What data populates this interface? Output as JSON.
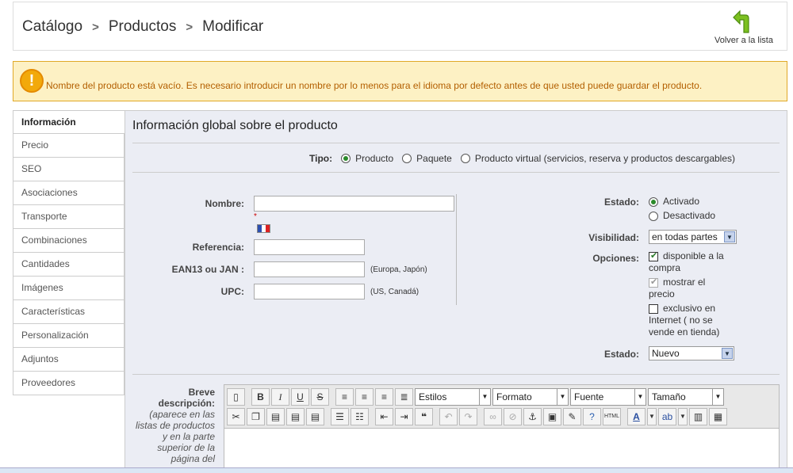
{
  "breadcrumb": {
    "items": [
      "Catálogo",
      "Productos",
      "Modificar"
    ],
    "separator": ">"
  },
  "back_button": {
    "label": "Volver a la lista",
    "icon": "arrow-back-icon"
  },
  "warning": {
    "icon": "!",
    "text": "Nombre del producto está vacío. Es necesario introducir un nombre por lo menos para el idioma por defecto antes de que usted puede guardar el producto."
  },
  "sidebar": {
    "items": [
      "Información",
      "Precio",
      "SEO",
      "Asociaciones",
      "Transporte",
      "Combinaciones",
      "Cantidades",
      "Imágenes",
      "Características",
      "Personalización",
      "Adjuntos",
      "Proveedores"
    ],
    "active_index": 0
  },
  "panel": {
    "title": "Información global sobre el producto",
    "tipo": {
      "label": "Tipo:",
      "options": [
        "Producto",
        "Paquete",
        "Producto virtual (servicios, reserva y productos descargables)"
      ],
      "selected_index": 0
    },
    "fields": {
      "nombre": {
        "label": "Nombre:",
        "value": "",
        "required_mark": "*"
      },
      "referencia": {
        "label": "Referencia:",
        "value": ""
      },
      "ean": {
        "label": "EAN13 ou JAN :",
        "value": "",
        "hint": "(Europa, Japón)"
      },
      "upc": {
        "label": "UPC:",
        "value": "",
        "hint": "(US, Canadá)"
      }
    },
    "estado": {
      "label": "Estado:",
      "options": [
        "Activado",
        "Desactivado"
      ],
      "selected_index": 0
    },
    "visibilidad": {
      "label": "Visibilidad:",
      "value": "en todas partes"
    },
    "opciones": {
      "label": "Opciones:",
      "items": [
        {
          "line1": "disponible a la",
          "line2": "compra",
          "checked": true,
          "disabled": false
        },
        {
          "line1": "mostrar el",
          "line2": "precio",
          "checked": true,
          "disabled": true
        },
        {
          "line1": "exclusivo en",
          "line2": "Internet ( no se",
          "line3": "vende en tienda)",
          "checked": false,
          "disabled": false
        }
      ]
    },
    "condicion": {
      "label": "Estado:",
      "value": "Nuevo"
    },
    "breve": {
      "label_line1": "Breve",
      "label_line2": "descripción:",
      "hint_lines": [
        "(aparece en las",
        "listas de productos",
        "y en la parte",
        "superior de la",
        "página del"
      ]
    },
    "editor": {
      "selects": [
        "Estilos",
        "Formato",
        "Fuente",
        "Tamaño"
      ]
    }
  },
  "colors": {
    "warning_bg": "#fdf1c4",
    "warning_text": "#b35f00",
    "panel_bg": "#ebedf4",
    "radio_on": "#2b8a2b"
  }
}
